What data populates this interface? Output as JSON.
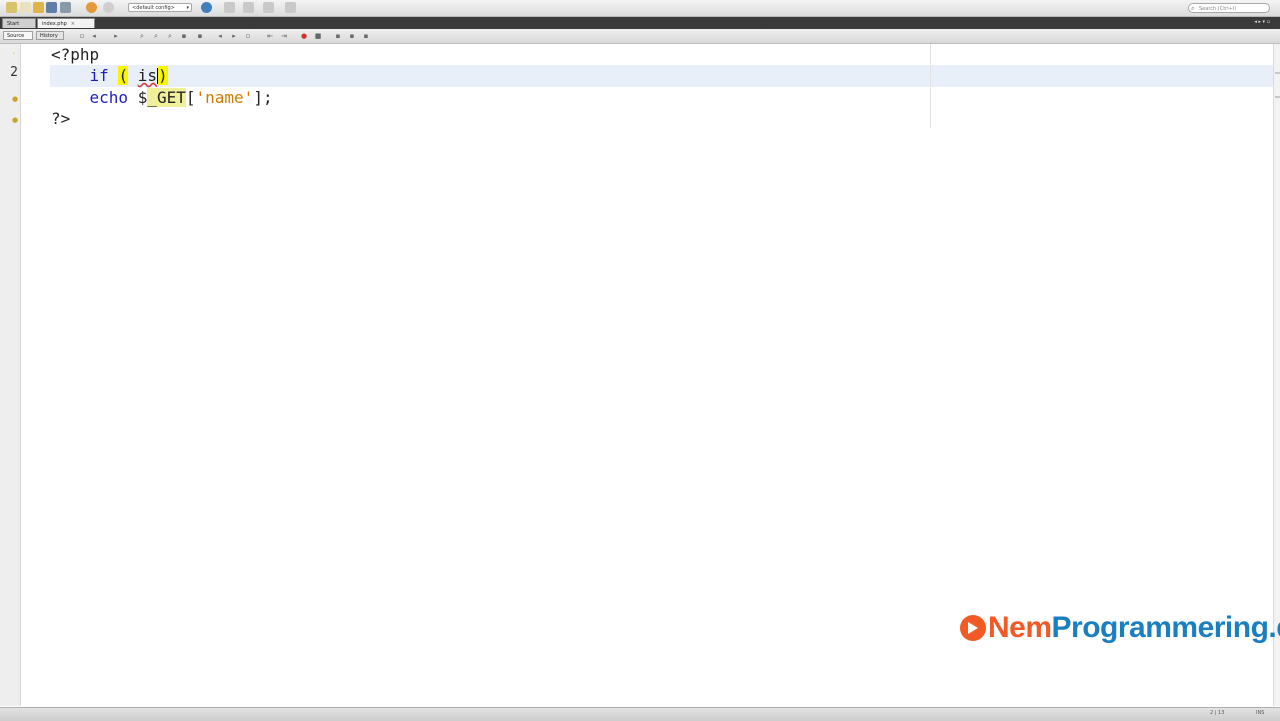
{
  "toolbar": {
    "project_select": "<default config>",
    "search_placeholder": "Search (Ctrl+I)"
  },
  "tabs": [
    {
      "label": "Start Page"
    },
    {
      "label": "index.php"
    }
  ],
  "editor_toolbar": {
    "source_tab": "Source",
    "history_tab": "History"
  },
  "gutter": {
    "current_line_number": "2"
  },
  "code": {
    "line1": "<?php",
    "line2_keyword": "if",
    "line2_open": "(",
    "line2_typed": "is",
    "line2_close": ")",
    "line3_keyword": "echo",
    "line3_var_dollar": "$",
    "line3_var_name": "_GET",
    "line3_bracket_open": "[",
    "line3_string": "'name'",
    "line3_end": "];",
    "line4": "?>"
  },
  "status": {
    "left": "",
    "position": "2 | 13",
    "mode": "INS"
  },
  "watermark": {
    "part_a": "Nem",
    "part_b": "Programmering.dk"
  },
  "colors": {
    "keyword": "#1f1fbf",
    "string": "#ce7b00",
    "brace_highlight": "#f7f600",
    "current_line": "#e9eff8",
    "brand_orange": "#f15a24",
    "brand_blue": "#1a7fc1"
  }
}
